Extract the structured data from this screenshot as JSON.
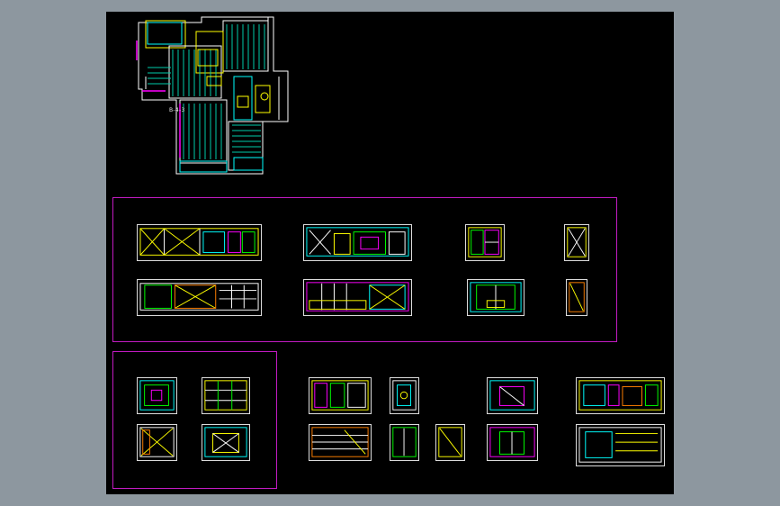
{
  "viewport": {
    "background_color": "#8d979f",
    "canvas_color": "#000000",
    "frame_color": "#c21bc2",
    "line_colors": [
      "#ffff00",
      "#00ffff",
      "#00ff00",
      "#ff00ff",
      "#ffffff",
      "#ff7f00",
      "#4a7cff"
    ]
  },
  "floor_plan": {
    "label": "B-4-3",
    "icon": "floor-plan-drawing"
  },
  "groups": {
    "elevations_top": {
      "icon": "elevation-sheet-group"
    },
    "elevations_left": {
      "icon": "elevation-sheet-group"
    },
    "elevations_right": {
      "icon": "elevation-sheet-group"
    }
  }
}
